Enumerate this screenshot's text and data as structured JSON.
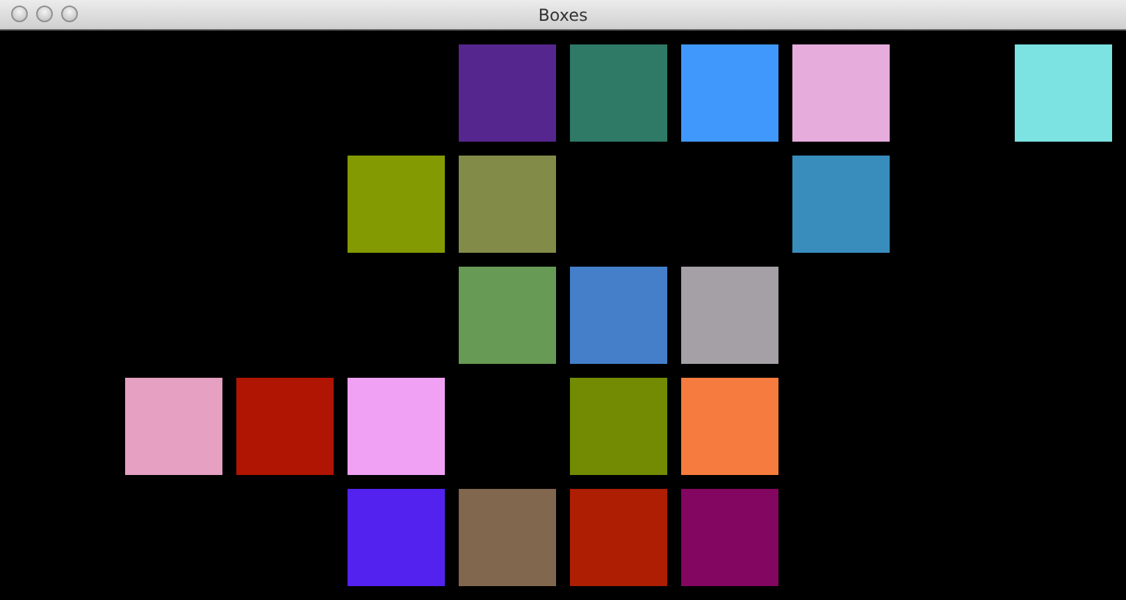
{
  "window": {
    "title": "Boxes"
  },
  "rows": [
    {
      "cells": [
        {
          "kind": "empty"
        },
        {
          "kind": "empty"
        },
        {
          "kind": "empty"
        },
        {
          "kind": "empty"
        },
        {
          "kind": "box",
          "color": "#56268f"
        },
        {
          "kind": "box",
          "color": "#2e7a66"
        },
        {
          "kind": "box",
          "color": "#4198fc"
        },
        {
          "kind": "box",
          "color": "#e6acdc"
        },
        {
          "kind": "empty"
        },
        {
          "kind": "box",
          "color": "#7ce2e2"
        }
      ]
    },
    {
      "cells": [
        {
          "kind": "empty"
        },
        {
          "kind": "empty"
        },
        {
          "kind": "empty"
        },
        {
          "kind": "box",
          "color": "#849a02"
        },
        {
          "kind": "box",
          "color": "#828c48"
        },
        {
          "kind": "empty"
        },
        {
          "kind": "empty"
        },
        {
          "kind": "box",
          "color": "#388dbd"
        },
        {
          "kind": "empty"
        },
        {
          "kind": "empty"
        }
      ]
    },
    {
      "cells": [
        {
          "kind": "empty"
        },
        {
          "kind": "empty"
        },
        {
          "kind": "empty"
        },
        {
          "kind": "empty"
        },
        {
          "kind": "box",
          "color": "#669a55"
        },
        {
          "kind": "box",
          "color": "#457fca"
        },
        {
          "kind": "box",
          "color": "#a4a0a6"
        },
        {
          "kind": "empty"
        },
        {
          "kind": "empty"
        },
        {
          "kind": "empty"
        }
      ]
    },
    {
      "cells": [
        {
          "kind": "empty"
        },
        {
          "kind": "box",
          "color": "#e6a0c1"
        },
        {
          "kind": "box",
          "color": "#b01402"
        },
        {
          "kind": "box",
          "color": "#f0a1f4"
        },
        {
          "kind": "empty"
        },
        {
          "kind": "box",
          "color": "#728b02"
        },
        {
          "kind": "box",
          "color": "#f57c3e"
        },
        {
          "kind": "empty"
        },
        {
          "kind": "empty"
        },
        {
          "kind": "empty"
        }
      ]
    },
    {
      "cells": [
        {
          "kind": "empty"
        },
        {
          "kind": "empty"
        },
        {
          "kind": "empty"
        },
        {
          "kind": "box",
          "color": "#5322ee"
        },
        {
          "kind": "box",
          "color": "#80674e"
        },
        {
          "kind": "box",
          "color": "#ad1e02"
        },
        {
          "kind": "box",
          "color": "#830660"
        },
        {
          "kind": "empty"
        },
        {
          "kind": "empty"
        },
        {
          "kind": "empty"
        }
      ]
    }
  ]
}
